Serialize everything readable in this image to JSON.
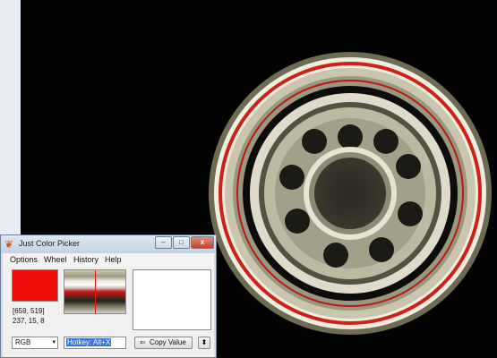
{
  "window": {
    "title": "Just Color Picker",
    "controls": {
      "minimize": "–",
      "maximize": "□",
      "close": "x"
    }
  },
  "menu": {
    "options": "Options",
    "wheel": "Wheel",
    "history": "History",
    "help": "Help"
  },
  "color": {
    "hex": "#ED0F08",
    "coordinates": "[659, 519]",
    "rgb_values": "237, 15, 8"
  },
  "format": {
    "selected": "RGB",
    "arrow": "▾"
  },
  "hotkey": {
    "value": "Hotkey: Alt+X"
  },
  "copy": {
    "icon": "⇐",
    "label": "Copy Value"
  },
  "spin": {
    "icon": "⬍"
  },
  "icons": {
    "app": "color-picker-app-icon",
    "copy": "copy-arrow-icon",
    "spin": "up-down-icon"
  }
}
